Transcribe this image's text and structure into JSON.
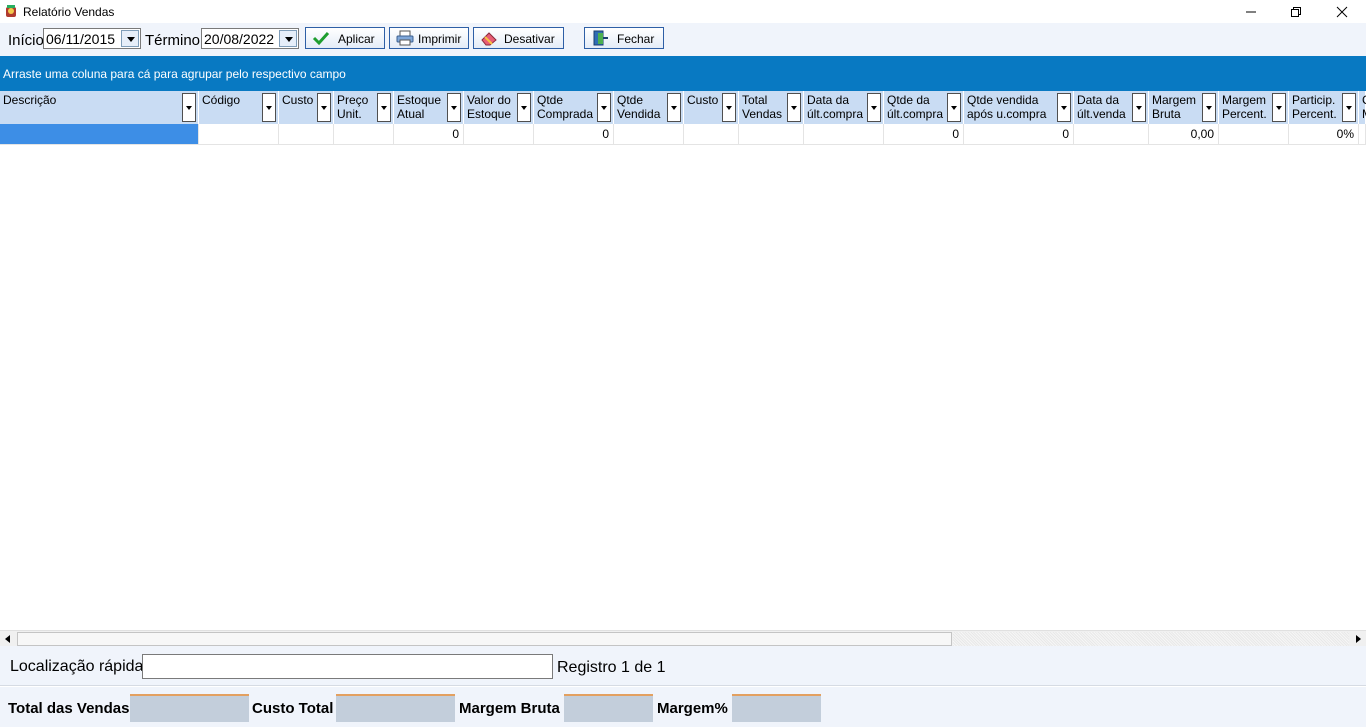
{
  "window": {
    "title": "Relatório Vendas"
  },
  "toolbar": {
    "inicio_label": "Início",
    "inicio_value": "06/11/2015",
    "termino_label": "Término",
    "termino_value": "20/08/2022",
    "aplicar_label": "Aplicar",
    "imprimir_label": "Imprimir",
    "desativar_label": "Desativar",
    "fechar_label": "Fechar"
  },
  "group_bar": {
    "text": "Arraste uma coluna para cá para agrupar pelo respectivo campo"
  },
  "grid": {
    "columns": [
      {
        "l1": "Descrição",
        "l2": ""
      },
      {
        "l1": "Código",
        "l2": ""
      },
      {
        "l1": "Custo",
        "l2": ""
      },
      {
        "l1": "Preço",
        "l2": "Unit."
      },
      {
        "l1": "Estoque",
        "l2": "Atual"
      },
      {
        "l1": "Valor do",
        "l2": "Estoque"
      },
      {
        "l1": "Qtde",
        "l2": "Comprada"
      },
      {
        "l1": "Qtde",
        "l2": "Vendida"
      },
      {
        "l1": "Custo",
        "l2": ""
      },
      {
        "l1": "Total",
        "l2": "Vendas"
      },
      {
        "l1": "Data da",
        "l2": "últ.compra"
      },
      {
        "l1": "Qtde da",
        "l2": "últ.compra"
      },
      {
        "l1": "Qtde vendida",
        "l2": "após u.compra"
      },
      {
        "l1": "Data da",
        "l2": "últ.venda"
      },
      {
        "l1": "Margem",
        "l2": "Bruta"
      },
      {
        "l1": "Margem",
        "l2": "Percent."
      },
      {
        "l1": "Particip.",
        "l2": "Percent."
      },
      {
        "l1": "C",
        "l2": "M"
      }
    ],
    "row": [
      "",
      "",
      "",
      "",
      "0",
      "",
      "0",
      "",
      "",
      "",
      "",
      "0",
      "0",
      "",
      "0,00",
      "",
      "0%",
      ""
    ]
  },
  "search": {
    "label": "Localização rápida",
    "value": "",
    "registro": "Registro 1 de 1"
  },
  "totals": {
    "total_vendas_label": "Total das Vendas",
    "custo_total_label": "Custo Total",
    "margem_bruta_label": "Margem Bruta",
    "margem_pct_label": "Margem%",
    "total_vendas_value": "",
    "custo_total_value": "",
    "margem_bruta_value": "",
    "margem_pct_value": ""
  }
}
